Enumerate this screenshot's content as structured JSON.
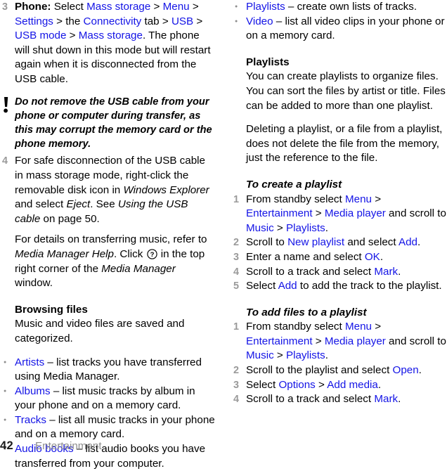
{
  "document": {
    "page_number": "42",
    "section": "Entertainment"
  },
  "left_column": {
    "step3": {
      "number": "3",
      "t1": "Phone:",
      "t2": " Select ",
      "l1": "Mass storage",
      "t3": " > ",
      "l2": "Menu",
      "t4": " > ",
      "l3": "Settings",
      "t5": " > the ",
      "l4": "Connectivity",
      "t6": " tab > ",
      "l5": "USB",
      "t7": " > ",
      "l6": "USB mode",
      "t8": " > ",
      "l7": "Mass storage",
      "t9": ". The phone will shut down in this mode but will restart again when it is disconnected from the USB cable."
    },
    "note": {
      "icon": "exclamation-icon",
      "text": "Do not remove the USB cable from your phone or computer during transfer, as this may corrupt the memory card or the phone memory."
    },
    "step4": {
      "number": "4",
      "t1": "For safe disconnection of the USB cable in mass storage mode, right-click the removable disk icon in ",
      "i1": "Windows Explorer",
      "t2": " and select ",
      "i2": "Eject",
      "t3": ". See ",
      "i3": "Using the USB cable",
      "t4": " on page 50.",
      "p2_t1": "For details on transferring music, refer to ",
      "p2_i1": "Media Manager Help",
      "p2_t2": ". Click ",
      "p2_icon": "help-question-icon",
      "p2_t3": " in the top right corner of the ",
      "p2_i2": "Media Manager",
      "p2_t4": " window."
    },
    "browsing_files": {
      "heading": "Browsing files",
      "body": "Music and video files are saved and categorized.",
      "items": [
        {
          "term": "Artists",
          "desc": " – list tracks you have transferred using Media Manager."
        },
        {
          "term": "Albums",
          "desc": " – list music tracks by album in your phone and on a memory card."
        },
        {
          "term": "Tracks",
          "desc": " – list all music tracks in your phone and on a memory card."
        },
        {
          "term": "Audio books",
          "desc": " – list audio books you have transferred from your computer."
        }
      ]
    }
  },
  "right_column": {
    "items": [
      {
        "term": "Playlists",
        "desc": " – create own lists of tracks."
      },
      {
        "term": "Video",
        "desc": " – list all video clips in your phone or on a memory card."
      }
    ],
    "playlists": {
      "heading": "Playlists",
      "body1": "You can create playlists to organize files. You can sort the files by artist or title. Files can be added to more than one playlist.",
      "body2": "Deleting a playlist, or a file from a playlist, does not delete the file from the memory, just the reference to the file."
    },
    "create_playlist": {
      "heading": "To create a playlist",
      "steps": [
        {
          "number": "1",
          "t1": "From standby select ",
          "l1": "Menu",
          "t2": " > ",
          "l2": "Entertainment",
          "t3": " > ",
          "l3": "Media player",
          "t4": " and scroll to ",
          "l4": "Music",
          "t5": " > ",
          "l5": "Playlists",
          "t6": "."
        },
        {
          "number": "2",
          "t1": "Scroll to ",
          "l1": "New playlist",
          "t2": " and select ",
          "l2": "Add",
          "t3": "."
        },
        {
          "number": "3",
          "t1": "Enter a name and select ",
          "l1": "OK",
          "t2": "."
        },
        {
          "number": "4",
          "t1": "Scroll to a track and select ",
          "l1": "Mark",
          "t2": "."
        },
        {
          "number": "5",
          "t1": "Select ",
          "l1": "Add",
          "t2": " to add the track to the playlist."
        }
      ]
    },
    "add_files": {
      "heading": "To add files to a playlist",
      "steps": [
        {
          "number": "1",
          "t1": "From standby select ",
          "l1": "Menu",
          "t2": " > ",
          "l2": "Entertainment",
          "t3": " > ",
          "l3": "Media player",
          "t4": " and scroll to ",
          "l4": "Music",
          "t5": " > ",
          "l5": "Playlists",
          "t6": "."
        },
        {
          "number": "2",
          "t1": "Scroll to the playlist and select ",
          "l1": "Open",
          "t2": "."
        },
        {
          "number": "3",
          "t1": "Select ",
          "l1": "Options",
          "t2": " > ",
          "l2": "Add media",
          "t3": "."
        },
        {
          "number": "4",
          "t1": "Scroll to a track and select ",
          "l1": "Mark",
          "t2": "."
        }
      ]
    }
  },
  "colors": {
    "link_blue": "#1414e6",
    "muted_gray": "#8d8d8d",
    "text_black": "#000000"
  }
}
